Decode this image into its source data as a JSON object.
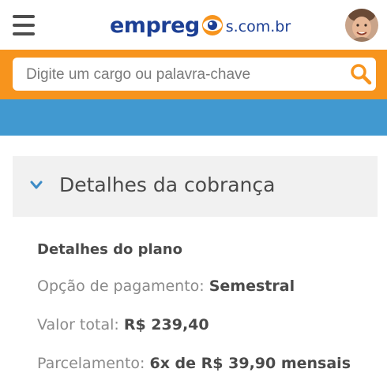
{
  "header": {
    "logo_brand": "empreg",
    "logo_suffix": "s.com.br",
    "menu_icon": "hamburger-menu-icon",
    "avatar_icon": "user-avatar"
  },
  "search": {
    "placeholder": "Digite um cargo ou palavra-chave",
    "value": "",
    "button_icon": "search-icon"
  },
  "colors": {
    "brand_blue": "#1c3f94",
    "search_band": "#f7941d",
    "blue_band": "#4199d0",
    "accordion_bg": "#f1f1f1"
  },
  "billing": {
    "section_title": "Detalhes da cobrança",
    "chevron_icon": "chevron-down-icon",
    "plan_title": "Detalhes do plano",
    "payment_option_label": "Opção de pagamento:",
    "payment_option_value": "Semestral",
    "total_label": "Valor total:",
    "total_value": "R$ 239,40",
    "installments_label": "Parcelamento:",
    "installments_value": "6x de R$ 39,90 mensais"
  }
}
